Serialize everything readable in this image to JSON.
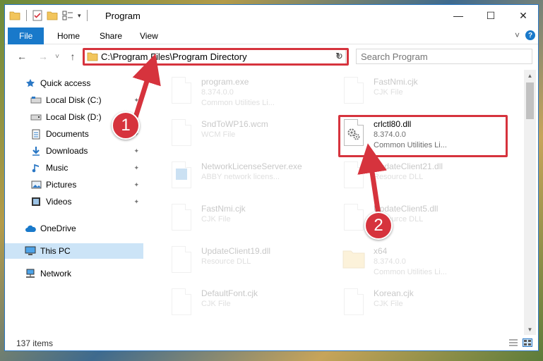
{
  "window": {
    "title": "Program",
    "controls": {
      "minimize": "—",
      "maximize": "☐",
      "close": "✕"
    }
  },
  "ribbon": {
    "tabs": [
      "File",
      "Home",
      "Share",
      "View"
    ],
    "expand": "˅",
    "help": "?"
  },
  "nav": {
    "back": "←",
    "forward": "→",
    "recent": "˅",
    "up": "↑",
    "address": "C:\\Program Files\\Program Directory",
    "address_dropdown": "˅",
    "refresh": "↻",
    "search_placeholder": "Search Program"
  },
  "sidebar": {
    "items": [
      {
        "label": "Quick access",
        "icon": "star-icon"
      },
      {
        "label": "Local Disk (C:)",
        "icon": "drive-icon"
      },
      {
        "label": "Local Disk (D:)",
        "icon": "drive-icon"
      },
      {
        "label": "Documents",
        "icon": "documents-icon"
      },
      {
        "label": "Downloads",
        "icon": "download-icon"
      },
      {
        "label": "Music",
        "icon": "music-icon"
      },
      {
        "label": "Pictures",
        "icon": "pictures-icon"
      },
      {
        "label": "Videos",
        "icon": "videos-icon"
      },
      {
        "label": "OneDrive",
        "icon": "cloud-icon"
      },
      {
        "label": "This PC",
        "icon": "computer-icon"
      },
      {
        "label": "Network",
        "icon": "network-icon"
      }
    ],
    "pin": "📌"
  },
  "files": [
    {
      "name": "program.exe",
      "line2": "8.374.0.0",
      "line3": "Common Utilities Li..."
    },
    {
      "name": "FastNmi.cjk",
      "line2": "CJK File",
      "line3": ""
    },
    {
      "name": "SndToWP16.wcm",
      "line2": "WCM File",
      "line3": ""
    },
    {
      "name": "crlctl80.dll",
      "line2": "8.374.0.0",
      "line3": "Common Utilities Li..."
    },
    {
      "name": "NetworkLicenseServer.exe",
      "line2": "ABBY network licens...",
      "line3": ""
    },
    {
      "name": "UpdateClient21.dll",
      "line2": "Resource DLL",
      "line3": ""
    },
    {
      "name": "FastNmi.cjk",
      "line2": "CJK File",
      "line3": ""
    },
    {
      "name": "UpdateClient5.dll",
      "line2": "Resource DLL",
      "line3": ""
    },
    {
      "name": "UpdateClient19.dll",
      "line2": "Resource DLL",
      "line3": ""
    },
    {
      "name": "x64",
      "line2": "8.374.0.0",
      "line3": "Common Utilities Li..."
    },
    {
      "name": "DefaultFont.cjk",
      "line2": "CJK File",
      "line3": ""
    },
    {
      "name": "Korean.cjk",
      "line2": "CJK File",
      "line3": ""
    }
  ],
  "status": {
    "count": "137 items"
  },
  "callouts": {
    "one": "1",
    "two": "2"
  },
  "colors": {
    "accent": "#1979ca",
    "highlight": "#d6333d",
    "selected": "#cce4f7"
  }
}
